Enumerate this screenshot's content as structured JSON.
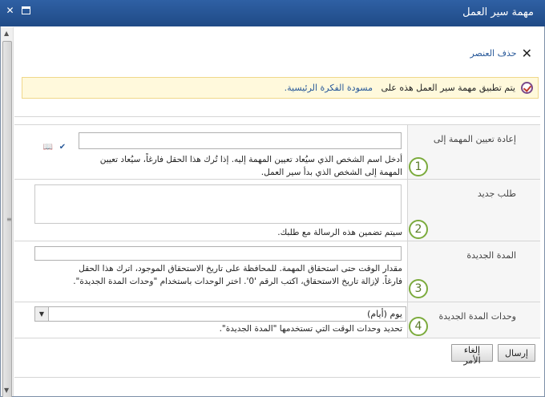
{
  "window": {
    "title": "مهمة سير العمل"
  },
  "toolbar": {
    "delete_label": "حذف العنصر"
  },
  "notice": {
    "prefix": "يتم تطبيق مهمة سير العمل هذه على",
    "link": "مسودة الفكرة الرئيسية."
  },
  "fields": [
    {
      "label": "إعادة تعيين المهمة إلى",
      "value": "",
      "help_line1": "أدخل اسم الشخص الذي سيُعاد تعيين المهمة إليه. إذا تُرك هذا الحقل فارغاً، سيُعاد تعيين",
      "help_line2": "المهمة إلى الشخص الذي بدأ سير العمل.",
      "badge": "1"
    },
    {
      "label": "طلب جديد",
      "value": "",
      "help_line1": "سيتم تضمين هذه الرسالة مع طلبك.",
      "badge": "2"
    },
    {
      "label": "المدة الجديدة",
      "value": "",
      "help_line1": "مقدار الوقت حتى استحقاق المهمة. للمحافظة على تاريخ الاستحقاق الموجود، اترك هذا الحقل",
      "help_line2": "فارغاً. لإزالة تاريخ الاستحقاق، اكتب الرقم '0'. اختر الوحدات باستخدام \"وحدات المدة الجديدة\".",
      "badge": "3"
    },
    {
      "label": "وحدات المدة الجديدة",
      "selected": "يوم (أيام)",
      "help_line1": "تحديد وحدات الوقت التي تستخدمها \"المدة الجديدة\".",
      "badge": "4"
    }
  ],
  "buttons": {
    "send": "إرسال",
    "cancel": "إلغاء الأمر"
  },
  "icons": {
    "close": "close-icon",
    "maximize": "maximize-icon",
    "delete": "x-icon",
    "notice": "check-circle-icon",
    "address_book": "address-book-icon",
    "check_names": "check-names-icon"
  }
}
